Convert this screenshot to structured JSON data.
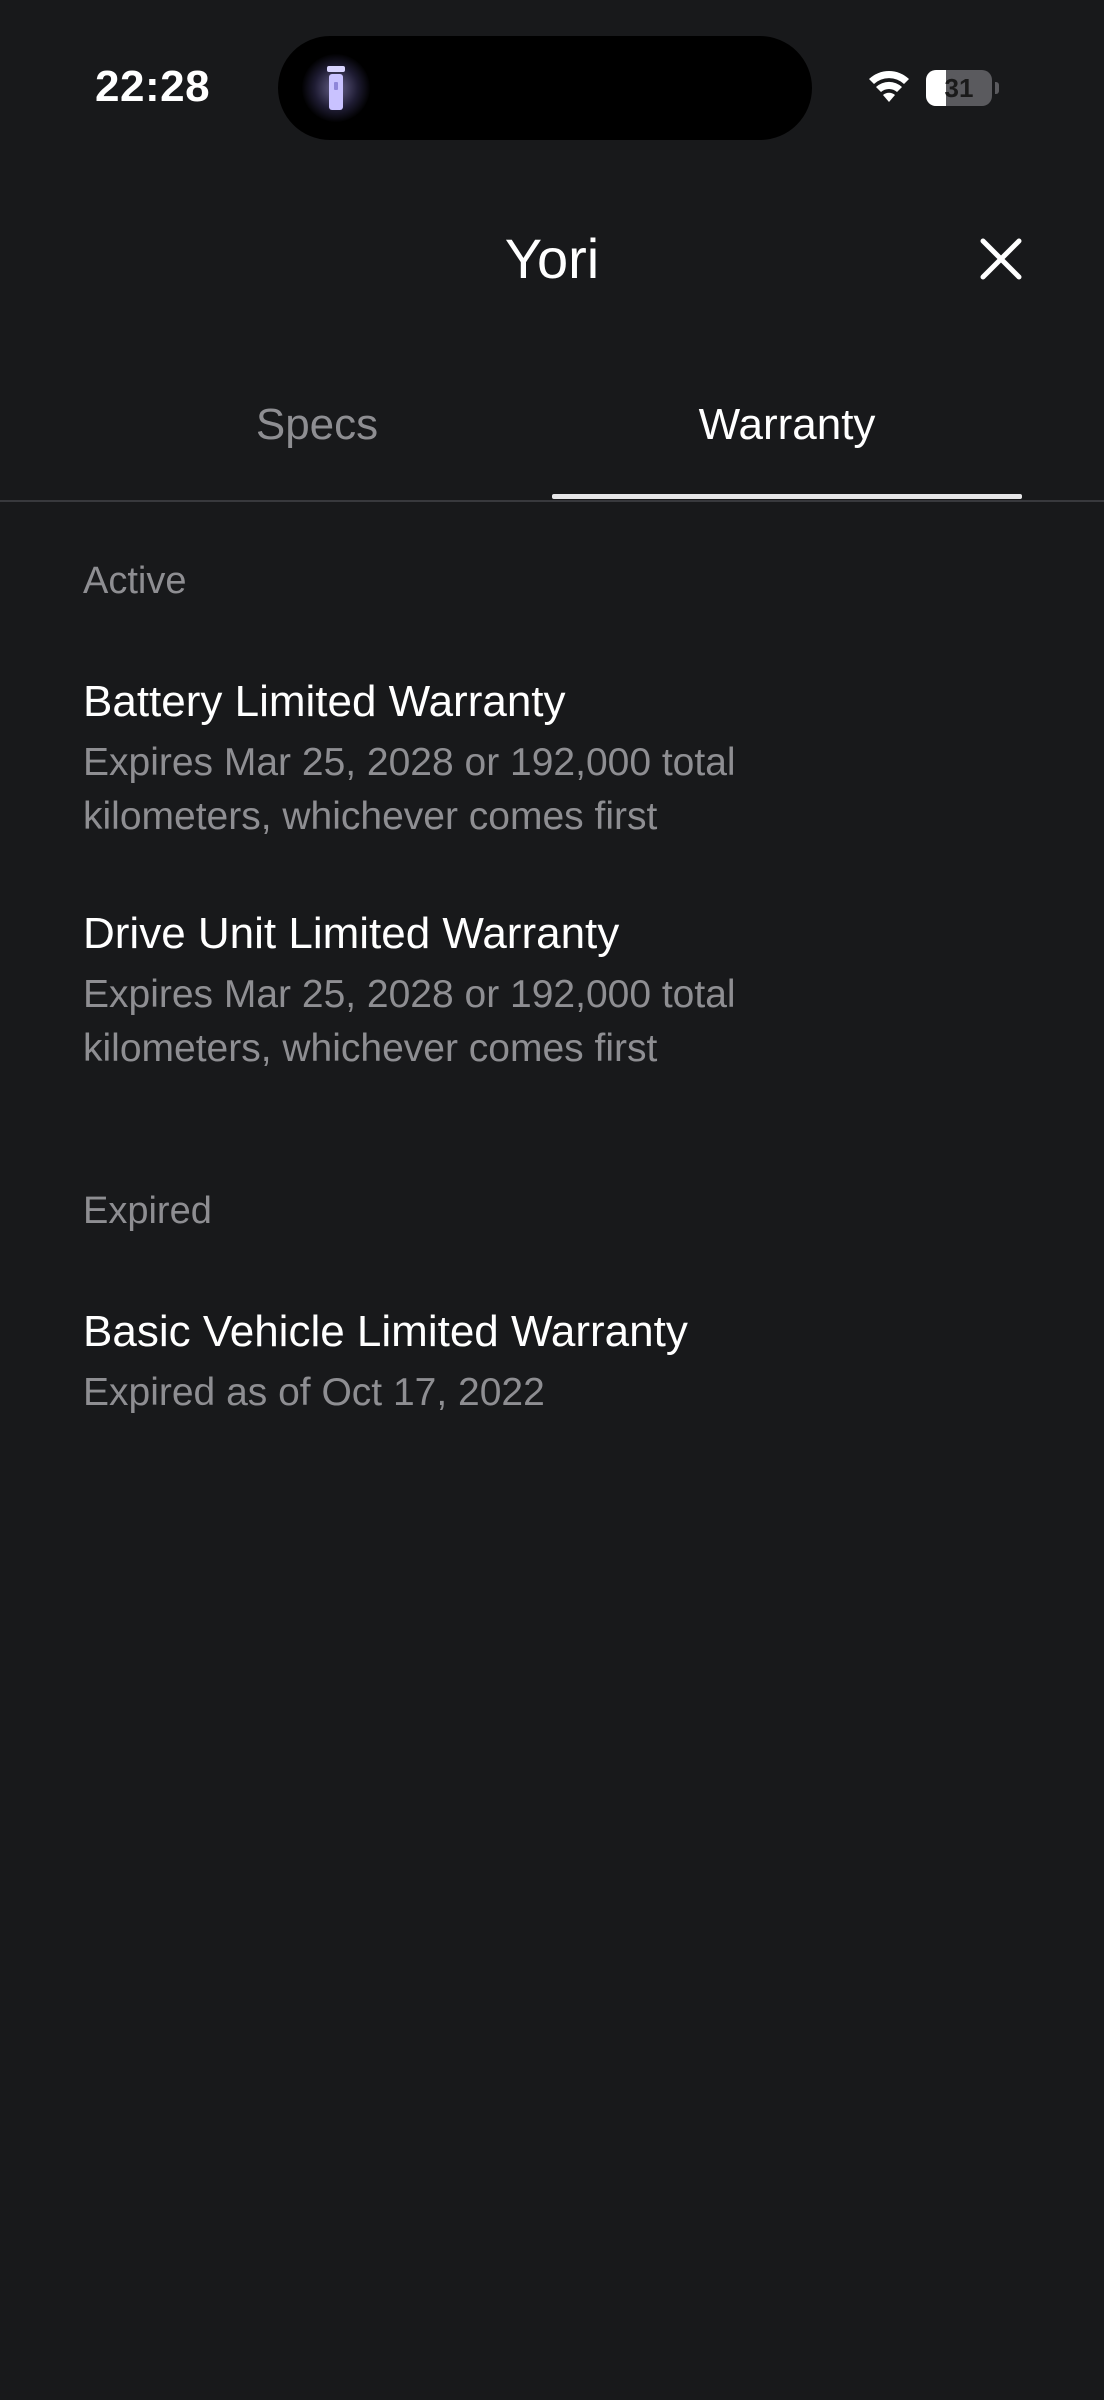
{
  "status_bar": {
    "time": "22:28",
    "battery_level": "31",
    "battery_fraction": 0.31,
    "icons": [
      "flashlight-icon",
      "wifi-icon",
      "battery-icon"
    ]
  },
  "header": {
    "title": "Yori",
    "close_icon": "close-icon"
  },
  "tabs": [
    {
      "label": "Specs",
      "active": false
    },
    {
      "label": "Warranty",
      "active": true
    }
  ],
  "sections": {
    "active": {
      "label": "Active",
      "items": [
        {
          "title": "Battery Limited Warranty",
          "description": "Expires Mar 25, 2028 or 192,000 total kilometers, whichever comes first"
        },
        {
          "title": "Drive Unit Limited Warranty",
          "description": "Expires Mar 25, 2028 or 192,000 total kilometers, whichever comes first"
        }
      ]
    },
    "expired": {
      "label": "Expired",
      "items": [
        {
          "title": "Basic Vehicle Limited Warranty",
          "description": "Expired as of Oct 17, 2022"
        }
      ]
    }
  },
  "colors": {
    "background": "#18191b",
    "primary_text": "#ffffff",
    "secondary_text": "#8e8e92",
    "tab_indicator": "#e6e6e8"
  }
}
